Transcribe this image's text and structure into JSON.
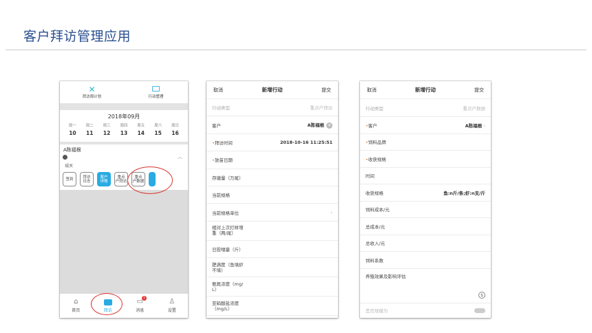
{
  "slide": {
    "title": "客户拜访管理应用"
  },
  "phone1": {
    "top_tabs": [
      {
        "label": "拜访周计划",
        "icon": "cross-icon"
      },
      {
        "label": "行动管理",
        "icon": "card-icon"
      }
    ],
    "calendar": {
      "month": "2018年09月",
      "weekdays": [
        "周一",
        "周二",
        "周三",
        "周四",
        "周五",
        "周六",
        "周日"
      ],
      "dates": [
        "10",
        "11",
        "12",
        "13",
        "14",
        "15",
        "16"
      ]
    },
    "customer": {
      "name": "A陈福根",
      "area": "城关"
    },
    "actions": [
      "签到",
      "拜访\n日志",
      "客户\n详情",
      "重点\n户拜访",
      "重点\n户数据"
    ],
    "tabbar": [
      {
        "label": "首页"
      },
      {
        "label": "拜访"
      },
      {
        "label": "消息",
        "badge": "1"
      },
      {
        "label": "设置"
      }
    ],
    "active_tab": "拜访",
    "accent_color": "#29abe2",
    "highlight_color": "#d8322c"
  },
  "phone2": {
    "header": {
      "cancel": "取消",
      "title": "新增行动",
      "submit": "提交"
    },
    "rows": [
      {
        "label": "行动类型",
        "value": "重点户拜访"
      },
      {
        "label": "客户",
        "value": "A陈福根"
      },
      {
        "label": "拜访时间",
        "value": "2018-10-16 11:25:51",
        "required": true
      },
      {
        "label": "放苗日期",
        "required": true
      },
      {
        "label": "存塘量（万尾）"
      },
      {
        "label": "当前规格"
      },
      {
        "label": "当前规格单位"
      },
      {
        "label": "相对上次打样增\n重（两/尾）"
      },
      {
        "label": "日投喂量（斤）"
      },
      {
        "label": "肥满度（鱼填虾\n不填）"
      },
      {
        "label": "氨氮浓度（mg/\nL）"
      },
      {
        "label": "亚硝酸盐浓度\n（mg/L）"
      }
    ]
  },
  "phone3": {
    "header": {
      "cancel": "取消",
      "title": "新增行动",
      "submit": "提交"
    },
    "rows": [
      {
        "label": "行动类型",
        "value": "重点户数据"
      },
      {
        "label": "客户",
        "value": "A陈福根",
        "required": true
      },
      {
        "label": "饲料品牌",
        "required": true
      },
      {
        "label": "收获规格",
        "required": true
      },
      {
        "label": "时间"
      },
      {
        "label": "收获规格",
        "value": "鱼:n斤/条;虾:n支/斤"
      },
      {
        "label": "饲料成本/元"
      },
      {
        "label": "总成本/元"
      },
      {
        "label": "总收入/元"
      },
      {
        "label": "饲料系数"
      },
      {
        "label": "养殖效果及影响评估"
      },
      {
        "label": "是否规模为"
      }
    ]
  }
}
